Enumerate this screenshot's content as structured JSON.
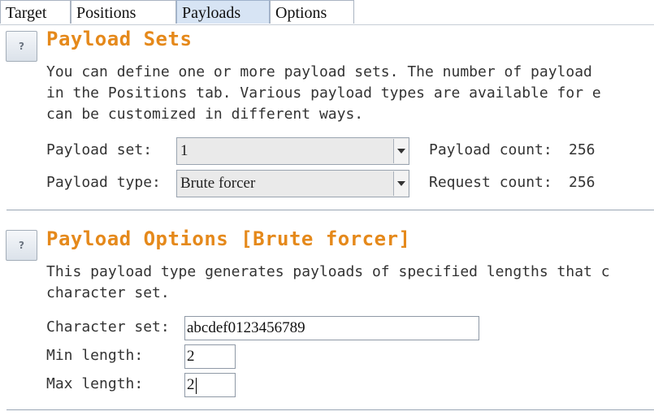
{
  "tabs": [
    "Target",
    "Positions",
    "Payloads",
    "Options"
  ],
  "active_tab": "Payloads",
  "payload_sets": {
    "title": "Payload Sets",
    "help_label": "?",
    "desc_lines": [
      "You can define one or more payload sets. The number of payload",
      "in the Positions tab. Various payload types are available for e",
      "can be customized in different ways."
    ],
    "set_label": "Payload set:",
    "set_value": "1",
    "type_label": "Payload type:",
    "type_value": "Brute forcer",
    "payload_count_label": "Payload count:",
    "payload_count": "256",
    "request_count_label": "Request count:",
    "request_count": "256"
  },
  "payload_options": {
    "title": "Payload Options [Brute forcer]",
    "help_label": "?",
    "desc_lines": [
      "This payload type generates payloads of specified lengths that c",
      "character set."
    ],
    "charset_label": "Character set:",
    "charset_value": "abcdef0123456789",
    "min_label": "Min length:",
    "min_value": "2",
    "max_label": "Max length:",
    "max_value": "2"
  }
}
